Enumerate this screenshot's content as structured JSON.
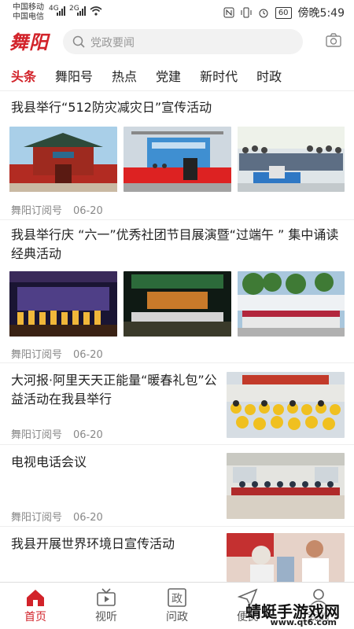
{
  "status_bar": {
    "carrier1": "中国移动",
    "carrier2": "中国电信",
    "sig1": "4G",
    "sig2": "2G",
    "battery": "60",
    "time": "傍晚5:49"
  },
  "header": {
    "logo": "舞阳",
    "search_placeholder": "党政要闻"
  },
  "tabs": [
    "头条",
    "舞阳号",
    "热点",
    "党建",
    "新时代",
    "时政"
  ],
  "articles": [
    {
      "title": "我县举行“512防灾减灾日”宣传活动",
      "source": "舞阳订阅号",
      "date": "06-20"
    },
    {
      "title_line1": "我县举行庆 “六一”优秀社团节目展演暨“过端午 ” 集中诵读",
      "title_line2": "经典活动",
      "source": "舞阳订阅号",
      "date": "06-20"
    },
    {
      "title_line1": "大河报·阿里天天正能量“暖春礼包”公",
      "title_line2": "益活动在我县举行",
      "source": "舞阳订阅号",
      "date": "06-20"
    },
    {
      "title": "电视电话会议",
      "source": "舞阳订阅号",
      "date": "06-20"
    },
    {
      "title": "我县开展世界环境日宣传活动"
    }
  ],
  "bottom_nav": [
    "首页",
    "视听",
    "问政",
    "便民",
    "我的"
  ],
  "watermark": {
    "text": "蜻蜓手游戏网",
    "url": "www.qt6.com"
  },
  "colors": {
    "accent": "#d2232a"
  }
}
